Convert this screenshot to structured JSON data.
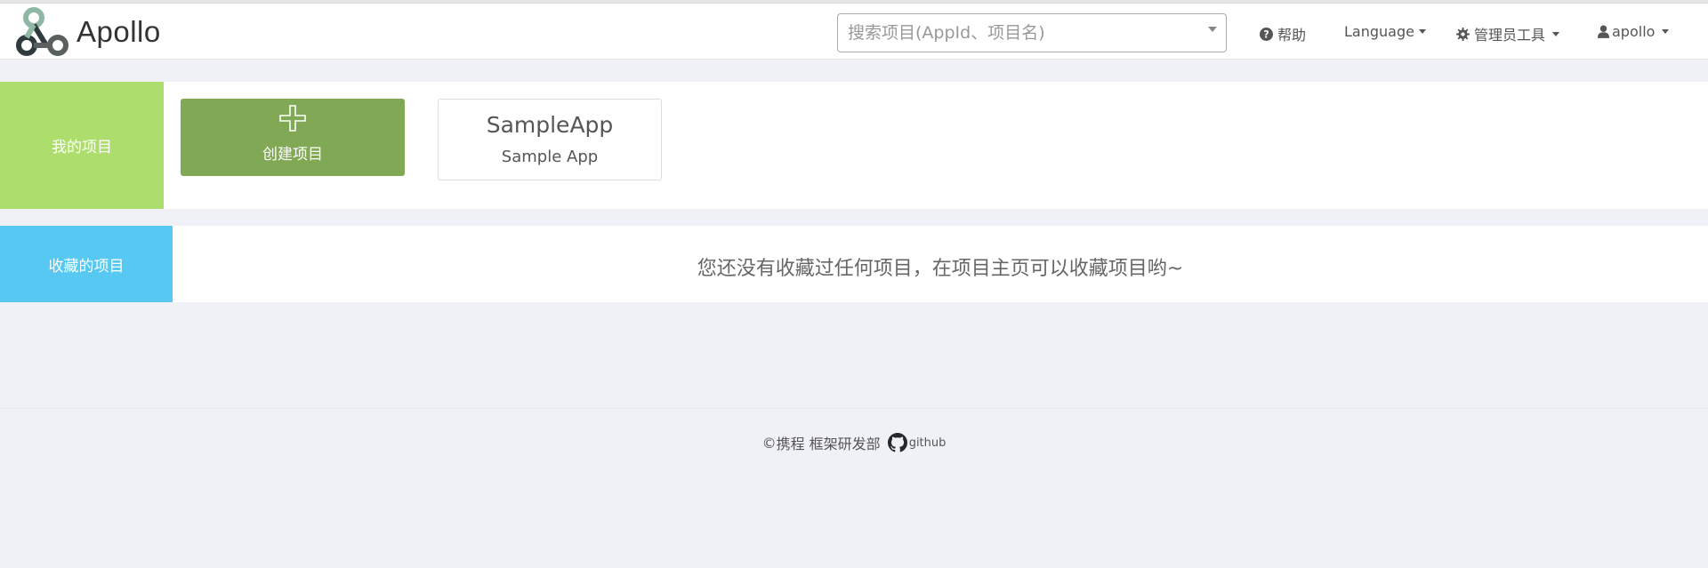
{
  "brand": {
    "name": "Apollo"
  },
  "header": {
    "search_placeholder": "搜索项目(AppId、项目名)",
    "help_label": "帮助",
    "language_label": "Language",
    "admin_label": "管理员工具",
    "user_label": "apollo",
    "icons": {
      "help": "question-circle-icon",
      "admin": "gear-icon",
      "user": "user-icon"
    }
  },
  "my_projects": {
    "label": "我的项目",
    "create_label": "创建项目",
    "apps": [
      {
        "app_id": "SampleApp",
        "name": "Sample App"
      }
    ],
    "colors": {
      "label_bg": "#addd6c",
      "create_bg": "#81a955"
    }
  },
  "favorites": {
    "label": "收藏的项目",
    "empty_message": "您还没有收藏过任何项目，在项目主页可以收藏项目哟~",
    "colors": {
      "label_bg": "#56c8f2"
    }
  },
  "footer": {
    "copyright_symbol": "©",
    "company": "携程 框架研发部",
    "github_label": "github"
  }
}
